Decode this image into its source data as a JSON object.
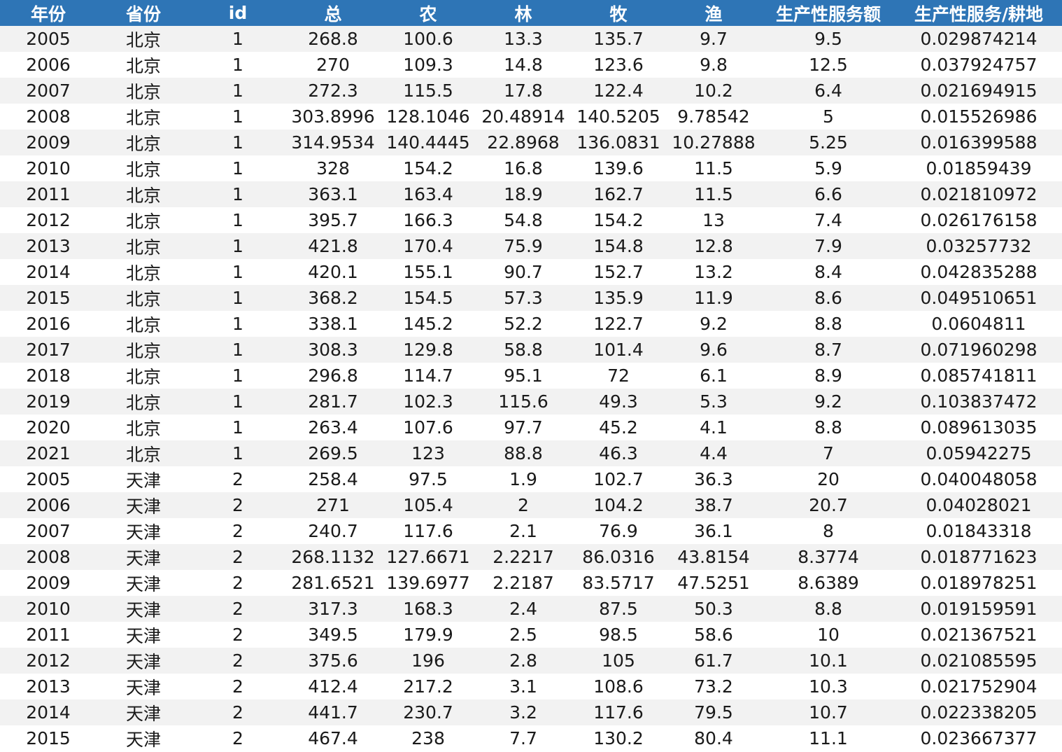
{
  "sheet": {
    "header_color": "#2e75b6",
    "stripe_color": "#f2f2f2",
    "columns": [
      "年份",
      "省份",
      "id",
      "总",
      "农",
      "林",
      "牧",
      "渔",
      "生产性服务额",
      "生产性服务/耕地"
    ],
    "rows": [
      [
        "2005",
        "北京",
        "1",
        "268.8",
        "100.6",
        "13.3",
        "135.7",
        "9.7",
        "9.5",
        "0.029874214"
      ],
      [
        "2006",
        "北京",
        "1",
        "270",
        "109.3",
        "14.8",
        "123.6",
        "9.8",
        "12.5",
        "0.037924757"
      ],
      [
        "2007",
        "北京",
        "1",
        "272.3",
        "115.5",
        "17.8",
        "122.4",
        "10.2",
        "6.4",
        "0.021694915"
      ],
      [
        "2008",
        "北京",
        "1",
        "303.8996",
        "128.1046",
        "20.48914",
        "140.5205",
        "9.78542",
        "5",
        "0.015526986"
      ],
      [
        "2009",
        "北京",
        "1",
        "314.9534",
        "140.4445",
        "22.8968",
        "136.0831",
        "10.27888",
        "5.25",
        "0.016399588"
      ],
      [
        "2010",
        "北京",
        "1",
        "328",
        "154.2",
        "16.8",
        "139.6",
        "11.5",
        "5.9",
        "0.01859439"
      ],
      [
        "2011",
        "北京",
        "1",
        "363.1",
        "163.4",
        "18.9",
        "162.7",
        "11.5",
        "6.6",
        "0.021810972"
      ],
      [
        "2012",
        "北京",
        "1",
        "395.7",
        "166.3",
        "54.8",
        "154.2",
        "13",
        "7.4",
        "0.026176158"
      ],
      [
        "2013",
        "北京",
        "1",
        "421.8",
        "170.4",
        "75.9",
        "154.8",
        "12.8",
        "7.9",
        "0.03257732"
      ],
      [
        "2014",
        "北京",
        "1",
        "420.1",
        "155.1",
        "90.7",
        "152.7",
        "13.2",
        "8.4",
        "0.042835288"
      ],
      [
        "2015",
        "北京",
        "1",
        "368.2",
        "154.5",
        "57.3",
        "135.9",
        "11.9",
        "8.6",
        "0.049510651"
      ],
      [
        "2016",
        "北京",
        "1",
        "338.1",
        "145.2",
        "52.2",
        "122.7",
        "9.2",
        "8.8",
        "0.0604811"
      ],
      [
        "2017",
        "北京",
        "1",
        "308.3",
        "129.8",
        "58.8",
        "101.4",
        "9.6",
        "8.7",
        "0.071960298"
      ],
      [
        "2018",
        "北京",
        "1",
        "296.8",
        "114.7",
        "95.1",
        "72",
        "6.1",
        "8.9",
        "0.085741811"
      ],
      [
        "2019",
        "北京",
        "1",
        "281.7",
        "102.3",
        "115.6",
        "49.3",
        "5.3",
        "9.2",
        "0.103837472"
      ],
      [
        "2020",
        "北京",
        "1",
        "263.4",
        "107.6",
        "97.7",
        "45.2",
        "4.1",
        "8.8",
        "0.089613035"
      ],
      [
        "2021",
        "北京",
        "1",
        "269.5",
        "123",
        "88.8",
        "46.3",
        "4.4",
        "7",
        "0.05942275"
      ],
      [
        "2005",
        "天津",
        "2",
        "258.4",
        "97.5",
        "1.9",
        "102.7",
        "36.3",
        "20",
        "0.040048058"
      ],
      [
        "2006",
        "天津",
        "2",
        "271",
        "105.4",
        "2",
        "104.2",
        "38.7",
        "20.7",
        "0.04028021"
      ],
      [
        "2007",
        "天津",
        "2",
        "240.7",
        "117.6",
        "2.1",
        "76.9",
        "36.1",
        "8",
        "0.01843318"
      ],
      [
        "2008",
        "天津",
        "2",
        "268.1132",
        "127.6671",
        "2.2217",
        "86.0316",
        "43.8154",
        "8.3774",
        "0.018771623"
      ],
      [
        "2009",
        "天津",
        "2",
        "281.6521",
        "139.6977",
        "2.2187",
        "83.5717",
        "47.5251",
        "8.6389",
        "0.018978251"
      ],
      [
        "2010",
        "天津",
        "2",
        "317.3",
        "168.3",
        "2.4",
        "87.5",
        "50.3",
        "8.8",
        "0.019159591"
      ],
      [
        "2011",
        "天津",
        "2",
        "349.5",
        "179.9",
        "2.5",
        "98.5",
        "58.6",
        "10",
        "0.021367521"
      ],
      [
        "2012",
        "天津",
        "2",
        "375.6",
        "196",
        "2.8",
        "105",
        "61.7",
        "10.1",
        "0.021085595"
      ],
      [
        "2013",
        "天津",
        "2",
        "412.4",
        "217.2",
        "3.1",
        "108.6",
        "73.2",
        "10.3",
        "0.021752904"
      ],
      [
        "2014",
        "天津",
        "2",
        "441.7",
        "230.7",
        "3.2",
        "117.6",
        "79.5",
        "10.7",
        "0.022338205"
      ],
      [
        "2015",
        "天津",
        "2",
        "467.4",
        "238",
        "7.7",
        "130.2",
        "80.4",
        "11.1",
        "0.023667377"
      ]
    ]
  }
}
